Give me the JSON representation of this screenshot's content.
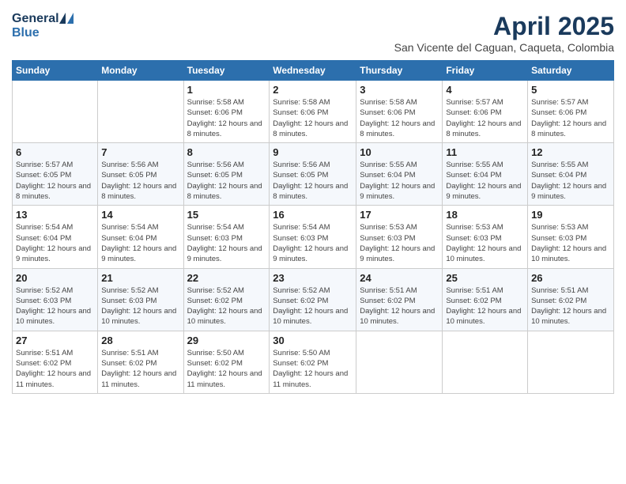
{
  "header": {
    "logo_general": "General",
    "logo_blue": "Blue",
    "month_title": "April 2025",
    "location": "San Vicente del Caguan, Caqueta, Colombia"
  },
  "days_of_week": [
    "Sunday",
    "Monday",
    "Tuesday",
    "Wednesday",
    "Thursday",
    "Friday",
    "Saturday"
  ],
  "weeks": [
    [
      {
        "day": "",
        "info": ""
      },
      {
        "day": "",
        "info": ""
      },
      {
        "day": "1",
        "info": "Sunrise: 5:58 AM\nSunset: 6:06 PM\nDaylight: 12 hours and 8 minutes."
      },
      {
        "day": "2",
        "info": "Sunrise: 5:58 AM\nSunset: 6:06 PM\nDaylight: 12 hours and 8 minutes."
      },
      {
        "day": "3",
        "info": "Sunrise: 5:58 AM\nSunset: 6:06 PM\nDaylight: 12 hours and 8 minutes."
      },
      {
        "day": "4",
        "info": "Sunrise: 5:57 AM\nSunset: 6:06 PM\nDaylight: 12 hours and 8 minutes."
      },
      {
        "day": "5",
        "info": "Sunrise: 5:57 AM\nSunset: 6:06 PM\nDaylight: 12 hours and 8 minutes."
      }
    ],
    [
      {
        "day": "6",
        "info": "Sunrise: 5:57 AM\nSunset: 6:05 PM\nDaylight: 12 hours and 8 minutes."
      },
      {
        "day": "7",
        "info": "Sunrise: 5:56 AM\nSunset: 6:05 PM\nDaylight: 12 hours and 8 minutes."
      },
      {
        "day": "8",
        "info": "Sunrise: 5:56 AM\nSunset: 6:05 PM\nDaylight: 12 hours and 8 minutes."
      },
      {
        "day": "9",
        "info": "Sunrise: 5:56 AM\nSunset: 6:05 PM\nDaylight: 12 hours and 8 minutes."
      },
      {
        "day": "10",
        "info": "Sunrise: 5:55 AM\nSunset: 6:04 PM\nDaylight: 12 hours and 9 minutes."
      },
      {
        "day": "11",
        "info": "Sunrise: 5:55 AM\nSunset: 6:04 PM\nDaylight: 12 hours and 9 minutes."
      },
      {
        "day": "12",
        "info": "Sunrise: 5:55 AM\nSunset: 6:04 PM\nDaylight: 12 hours and 9 minutes."
      }
    ],
    [
      {
        "day": "13",
        "info": "Sunrise: 5:54 AM\nSunset: 6:04 PM\nDaylight: 12 hours and 9 minutes."
      },
      {
        "day": "14",
        "info": "Sunrise: 5:54 AM\nSunset: 6:04 PM\nDaylight: 12 hours and 9 minutes."
      },
      {
        "day": "15",
        "info": "Sunrise: 5:54 AM\nSunset: 6:03 PM\nDaylight: 12 hours and 9 minutes."
      },
      {
        "day": "16",
        "info": "Sunrise: 5:54 AM\nSunset: 6:03 PM\nDaylight: 12 hours and 9 minutes."
      },
      {
        "day": "17",
        "info": "Sunrise: 5:53 AM\nSunset: 6:03 PM\nDaylight: 12 hours and 9 minutes."
      },
      {
        "day": "18",
        "info": "Sunrise: 5:53 AM\nSunset: 6:03 PM\nDaylight: 12 hours and 10 minutes."
      },
      {
        "day": "19",
        "info": "Sunrise: 5:53 AM\nSunset: 6:03 PM\nDaylight: 12 hours and 10 minutes."
      }
    ],
    [
      {
        "day": "20",
        "info": "Sunrise: 5:52 AM\nSunset: 6:03 PM\nDaylight: 12 hours and 10 minutes."
      },
      {
        "day": "21",
        "info": "Sunrise: 5:52 AM\nSunset: 6:03 PM\nDaylight: 12 hours and 10 minutes."
      },
      {
        "day": "22",
        "info": "Sunrise: 5:52 AM\nSunset: 6:02 PM\nDaylight: 12 hours and 10 minutes."
      },
      {
        "day": "23",
        "info": "Sunrise: 5:52 AM\nSunset: 6:02 PM\nDaylight: 12 hours and 10 minutes."
      },
      {
        "day": "24",
        "info": "Sunrise: 5:51 AM\nSunset: 6:02 PM\nDaylight: 12 hours and 10 minutes."
      },
      {
        "day": "25",
        "info": "Sunrise: 5:51 AM\nSunset: 6:02 PM\nDaylight: 12 hours and 10 minutes."
      },
      {
        "day": "26",
        "info": "Sunrise: 5:51 AM\nSunset: 6:02 PM\nDaylight: 12 hours and 10 minutes."
      }
    ],
    [
      {
        "day": "27",
        "info": "Sunrise: 5:51 AM\nSunset: 6:02 PM\nDaylight: 12 hours and 11 minutes."
      },
      {
        "day": "28",
        "info": "Sunrise: 5:51 AM\nSunset: 6:02 PM\nDaylight: 12 hours and 11 minutes."
      },
      {
        "day": "29",
        "info": "Sunrise: 5:50 AM\nSunset: 6:02 PM\nDaylight: 12 hours and 11 minutes."
      },
      {
        "day": "30",
        "info": "Sunrise: 5:50 AM\nSunset: 6:02 PM\nDaylight: 12 hours and 11 minutes."
      },
      {
        "day": "",
        "info": ""
      },
      {
        "day": "",
        "info": ""
      },
      {
        "day": "",
        "info": ""
      }
    ]
  ]
}
